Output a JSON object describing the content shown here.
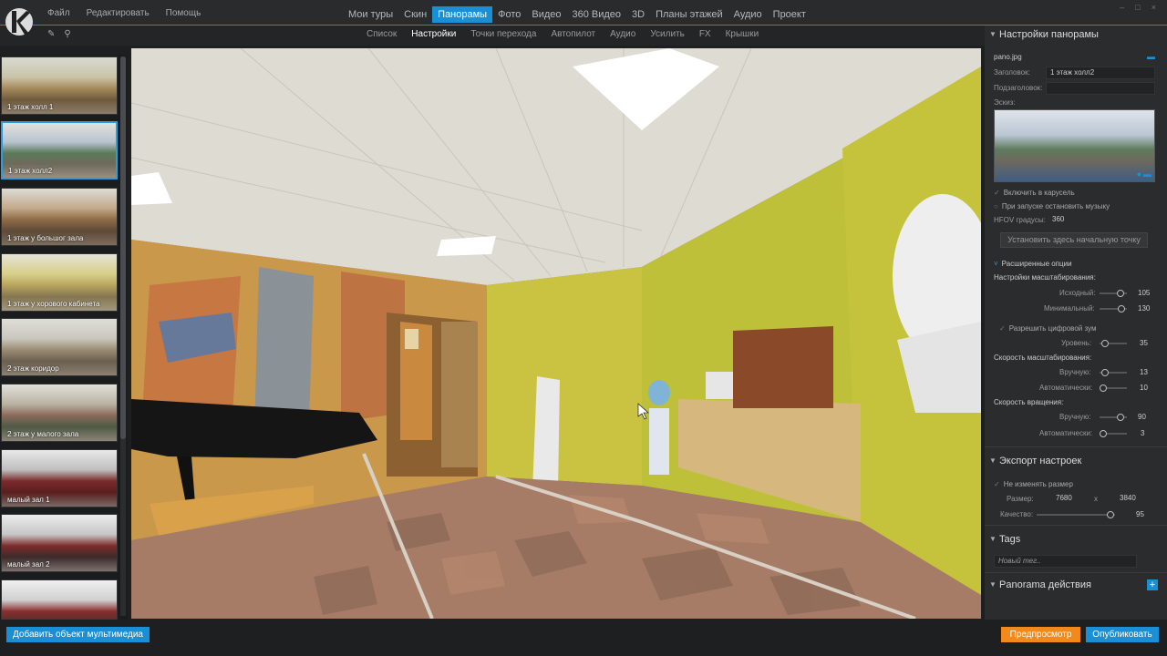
{
  "menu": [
    "Файл",
    "Редактировать",
    "Помощь"
  ],
  "main_tabs": [
    "Мои туры",
    "Скин",
    "Панорамы",
    "Фото",
    "Видео",
    "360 Видео",
    "3D",
    "Планы этажей",
    "Аудио",
    "Проект"
  ],
  "active_main_tab": "Панорамы",
  "sub_tabs": [
    "Список",
    "Настройки",
    "Точки перехода",
    "Автопилот",
    "Аудио",
    "Усилить",
    "FX",
    "Крышки"
  ],
  "active_sub_tab": "Настройки",
  "panoramas": [
    {
      "label": "1 этаж холл 1"
    },
    {
      "label": "1 этаж холл2",
      "selected": true
    },
    {
      "label": "1 этаж у большог зала"
    },
    {
      "label": "1 этаж у хорового кабинета"
    },
    {
      "label": "2 этаж коридор"
    },
    {
      "label": "2 этаж у малого зала"
    },
    {
      "label": "малый зал 1"
    },
    {
      "label": "малый зал 2"
    },
    {
      "label": ""
    }
  ],
  "settings": {
    "header": "Настройки панорамы",
    "file": "pano.jpg",
    "title_label": "Заголовок:",
    "title_value": "1 этаж холл2",
    "subtitle_label": "Подзаголовок:",
    "subtitle_value": "",
    "thumb_label": "Эскиз:",
    "carousel_label": "Включить в карусель",
    "carousel_checked": true,
    "stop_music_label": "При запуске остановить музыку",
    "stop_music_checked": false,
    "hfov_label": "HFOV градусы:",
    "hfov_value": "360",
    "start_button": "Установить здесь начальную точку",
    "advanced_label": "Расширенные опции",
    "zoom_settings_label": "Настройки масштабирования:",
    "initial_label": "Исходный:",
    "initial_value": "105",
    "minimum_label": "Минимальный:",
    "minimum_value": "130",
    "digital_zoom_label": "Разрешить цифровой зум",
    "level_label": "Уровень:",
    "level_value": "35",
    "zoom_speed_label": "Скорость масштабирования:",
    "manual_label": "Вручную:",
    "zoom_manual_value": "13",
    "auto_label": "Автоматически:",
    "zoom_auto_value": "10",
    "rotation_speed_label": "Скорость вращения:",
    "rot_manual_value": "90",
    "rot_auto_value": "3"
  },
  "export": {
    "header": "Экспорт настроек",
    "keep_size_label": "Не изменять размер",
    "size_label": "Размер:",
    "width": "7680",
    "x": "x",
    "height": "3840",
    "quality_label": "Качество:",
    "quality": "95"
  },
  "tags": {
    "header": "Tags",
    "placeholder": "Новый тег.."
  },
  "actions": {
    "header": "Panorama действия",
    "add": "+"
  },
  "bottom": {
    "add_media": "Добавить объект мультимедиа",
    "preview": "Предпросмотр",
    "publish": "Опубликовать"
  },
  "colors": {
    "accent": "#1b8fd6",
    "preview": "#f28a1b"
  }
}
